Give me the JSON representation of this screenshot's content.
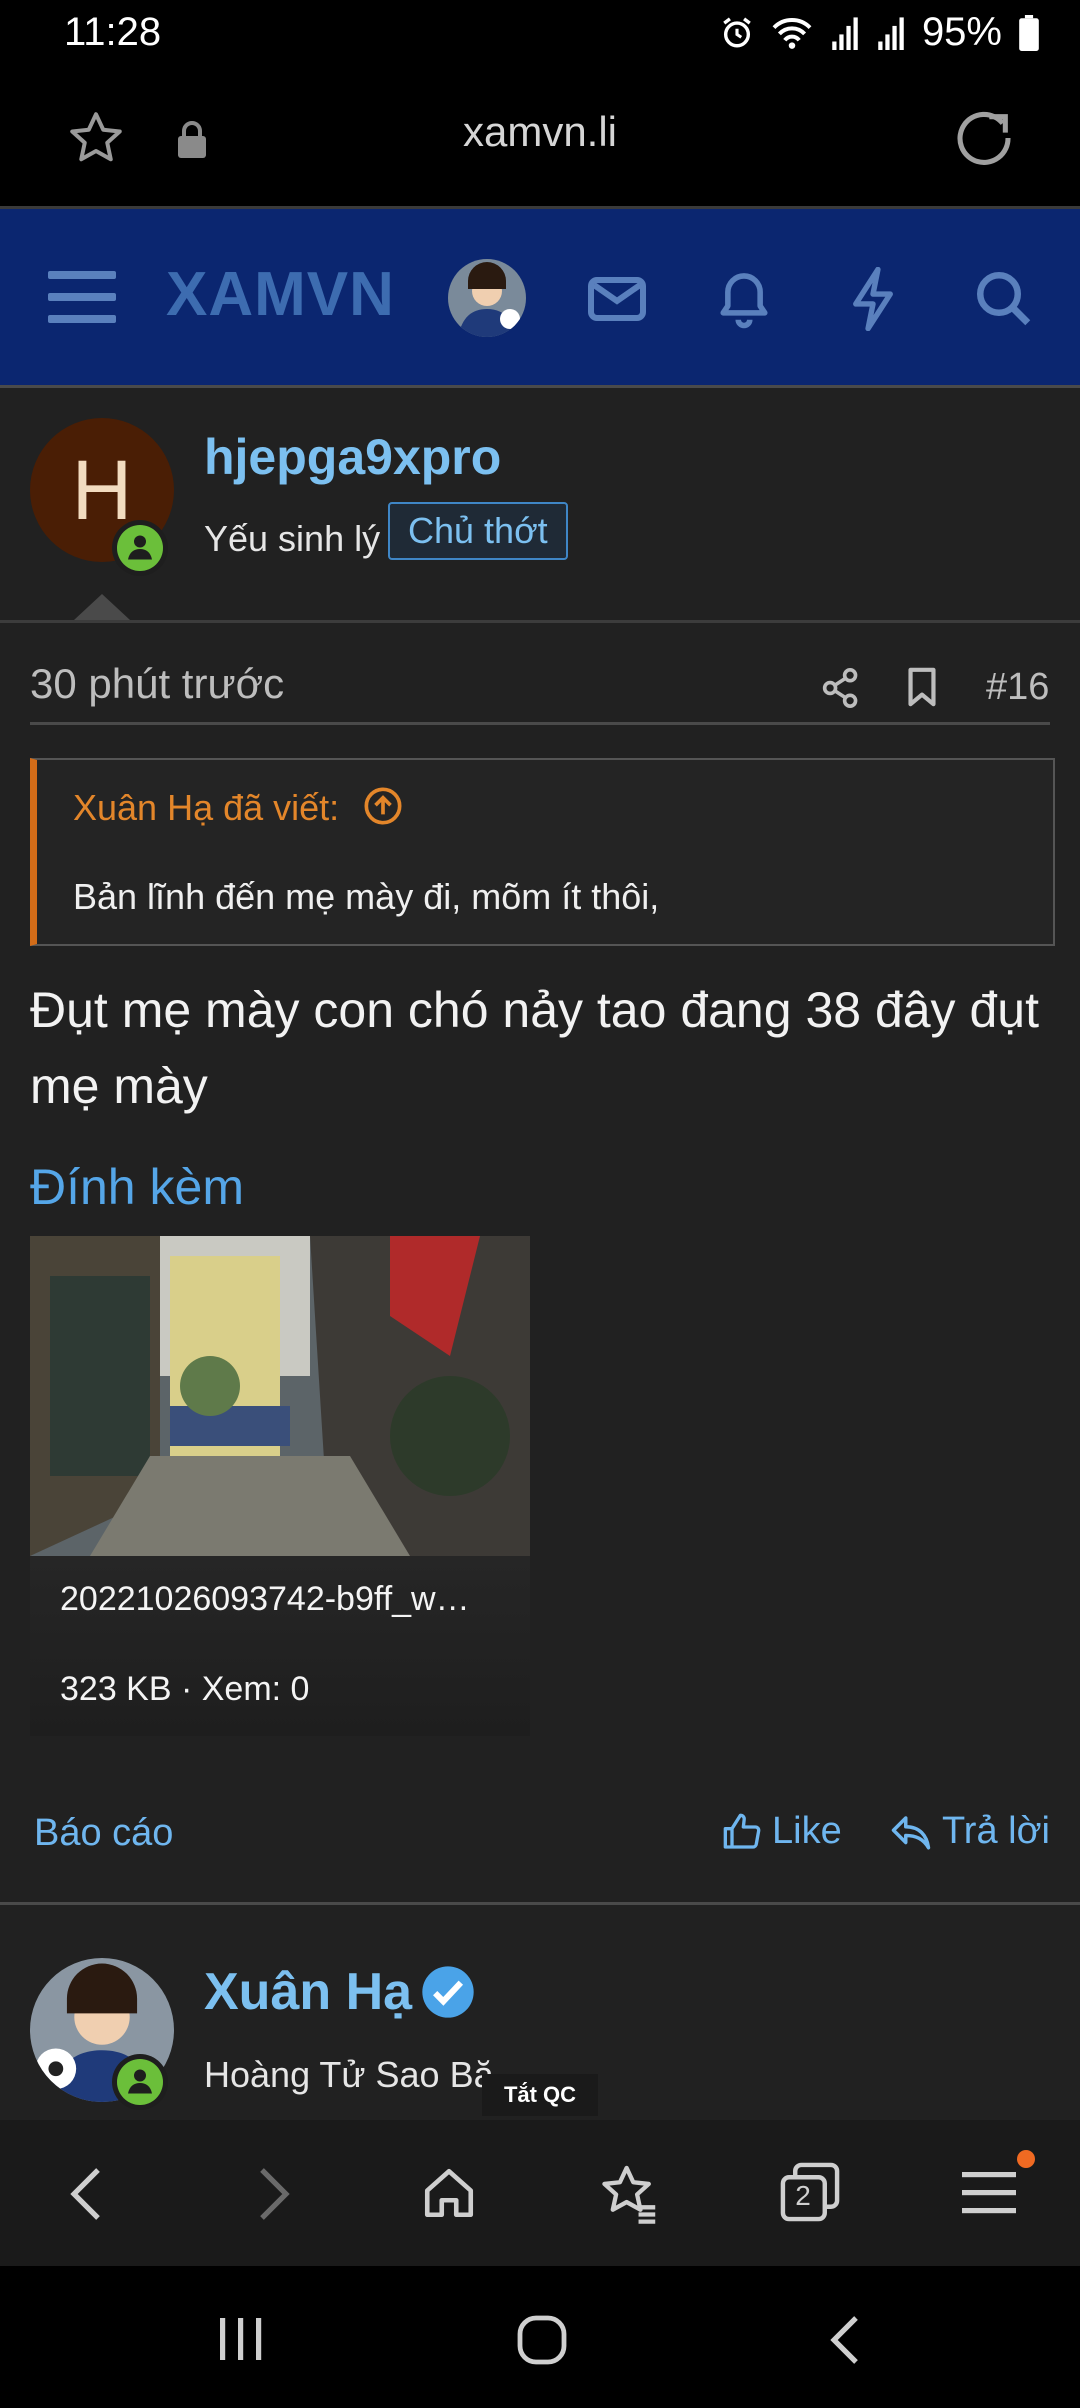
{
  "status_bar": {
    "time": "11:28",
    "battery": "95%",
    "icons": [
      "alarm-icon",
      "wifi-icon",
      "signal-icon",
      "signal-icon",
      "battery-icon"
    ]
  },
  "browser": {
    "url": "xamvn.li",
    "tab_count": "2"
  },
  "site": {
    "logo": "XAMVN"
  },
  "post": {
    "author": "hjepga9xpro",
    "author_initial": "H",
    "author_title": "Yếu sinh lý",
    "author_badge": "Chủ thớt",
    "time": "30 phút trước",
    "post_number": "#16",
    "quote": {
      "author_line": "Xuân Hạ đã viết:",
      "text": "Bản lĩnh đến mẹ mày đi, mõm ít thôi,"
    },
    "body": "Đụt mẹ mày con chó nảy tao đang 38 đây đụt mẹ mày",
    "attachments_title": "Đính kèm",
    "attachment": {
      "filename": "20221026093742-b9ff_w…",
      "info": "323 KB · Xem: 0"
    },
    "actions": {
      "report": "Báo cáo",
      "like": "Like",
      "reply": "Trả lời"
    }
  },
  "next_post": {
    "author": "Xuân Hạ",
    "author_title": "Hoàng Tử Sao Bă"
  },
  "ad_tag": "Tắt QC",
  "colors": {
    "header_bg": "#0b2670",
    "link": "#7cc0f0",
    "quote_accent": "#d36c18",
    "online": "#6bbf3a"
  }
}
